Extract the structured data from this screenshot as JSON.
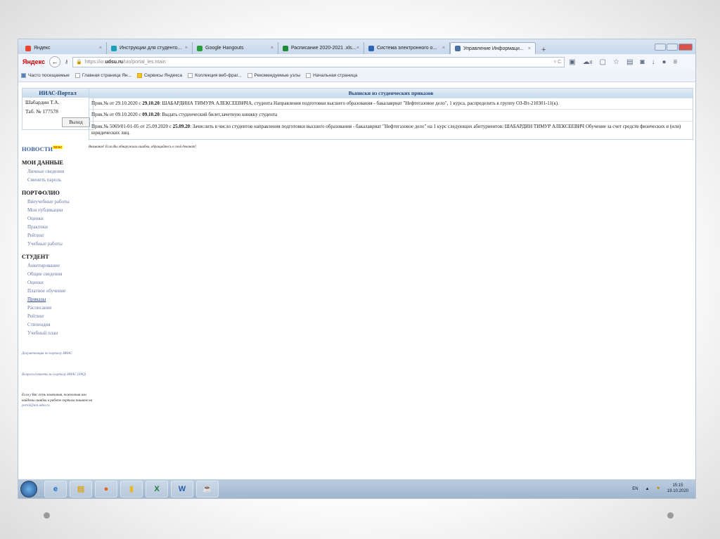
{
  "browser": {
    "tabs": [
      {
        "label": "Яндекс",
        "color": "#e43"
      },
      {
        "label": "Инструкции для студенто...",
        "color": "#1aa0b8"
      },
      {
        "label": "Google Hangouts",
        "color": "#2a9d3c"
      },
      {
        "label": "Расписание 2020-2021 .xls...",
        "color": "#1d8a3a"
      },
      {
        "label": "Система электронного о...",
        "color": "#2a66b5"
      },
      {
        "label": "Управление Информаци...",
        "color": "#4a6fa8",
        "active": true
      }
    ],
    "close_glyph": "×",
    "new_tab": "+",
    "logo": "Яндекс",
    "url_prefix": "https://io.",
    "url_domain": "udsu.ru",
    "url_path": "/uio/portal_ies.main",
    "cloud_count": "8",
    "bookmarks": [
      "Часто посещаемые",
      "Главная страница Ян...",
      "Сервисы Яндекса",
      "Коллекция веб-фраг...",
      "Рекомендуемые узлы",
      "Начальная страница"
    ]
  },
  "sidebar": {
    "portal_title": "ИИАС-Портал",
    "user_name": "Шабардин Т.А.",
    "tab_number": "Таб. № 177578",
    "exit": "Выход",
    "news": "НОВОСТИ",
    "news_badge": "NEW!",
    "sections": [
      {
        "title": "МОИ ДАННЫЕ",
        "items": [
          "Личные сведения",
          "Сменить пароль"
        ]
      },
      {
        "title": "ПОРТФОЛИО",
        "items": [
          "Внеучебные работы",
          "Мои публикации",
          "Оценки",
          "Практики",
          "Рейтинг",
          "Учебные работы"
        ]
      },
      {
        "title": "СТУДЕНТ",
        "items": [
          "Анкетирование",
          "Общие сведения",
          "Оценки",
          "Платное обучение",
          "Приказы",
          "Расписание",
          "Рейтинг",
          "Стипендия",
          "Учебный план"
        ]
      }
    ],
    "doc_link": "Документация по порталу ИИАС",
    "faq_link": "Вопросы/ответы по порталу ИИАС (FAQ)",
    "feedback_text": "Если у Вас есть замечания, пожелания или найдены ошибки в работе портала пишите на",
    "feedback_email": "portal@uni.udsu.ru"
  },
  "main": {
    "table_title": "Выписки из студенческих приказов",
    "orders": [
      {
        "prefix": "Прик.№ от 29.10.2020 с ",
        "date": "29.10.20",
        "text": ": ШАБАРДИНА ТИМУРА АЛЕКСЕЕВИЧА, студента Направления подготовки высшего образования - бакалавриат \"Нефтегазовое дело\", 1 курса, распределить в группу ОЗ-Вт-210301-11(к)."
      },
      {
        "prefix": "Прик.№ от 09.10.2020 с ",
        "date": "09.10.20",
        "text": ": Выдать студенческий билет,зачетную книжку студента"
      },
      {
        "prefix": "Прик.№ 5069/01-01-05 от 25.09.2020 с ",
        "date": "25.09.20",
        "text": ": Зачислить в число студентов направления подготовки высшего образования - бакалавриат \"Нефтегазовое дело\" на 1 курс следующих абитуриентов: ШАБАРДИН ТИМУР АЛЕКСЕЕВИЧ Обучение за счет средств физических и (или) юридических лиц."
      }
    ],
    "warning": "Внимание! Если Вы обнаружили ошибки, обращайтесь в свой деканат!"
  },
  "taskbar": {
    "apps": [
      {
        "name": "ie",
        "glyph": "e",
        "color": "#1e6fc4"
      },
      {
        "name": "explorer",
        "glyph": "▤",
        "color": "#d8a623"
      },
      {
        "name": "firefox",
        "glyph": "●",
        "color": "#e3661d"
      },
      {
        "name": "folder",
        "glyph": "▮",
        "color": "#e4b830"
      },
      {
        "name": "excel",
        "glyph": "X",
        "color": "#1d7a3c"
      },
      {
        "name": "word",
        "glyph": "W",
        "color": "#2a5caa"
      },
      {
        "name": "java",
        "glyph": "☕",
        "color": "#a05a2c"
      }
    ],
    "lang": "EN",
    "time": "15:15",
    "date": "19.10.2020"
  }
}
